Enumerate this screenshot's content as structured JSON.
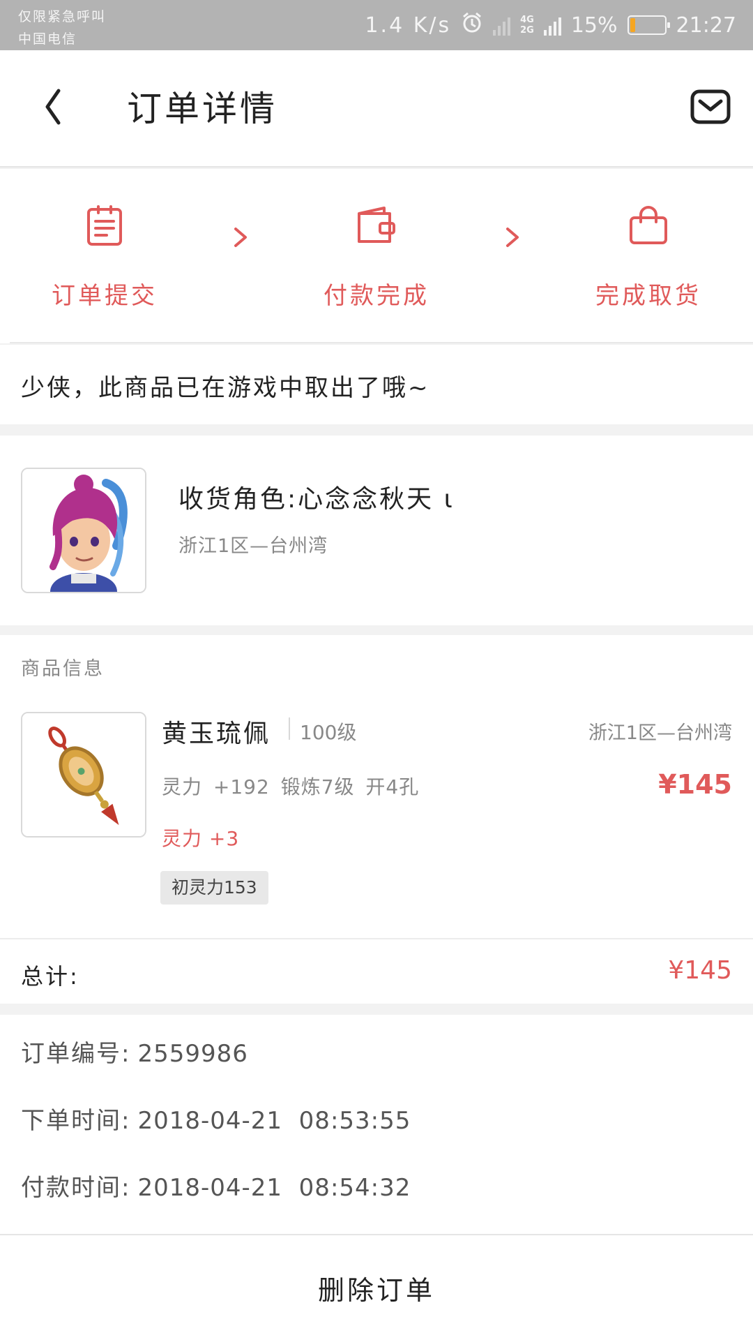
{
  "status_bar": {
    "emergency_text": "仅限紧急呼叫",
    "carrier": "中国电信",
    "speed": "1.4 K/s",
    "net_type_top": "4G",
    "net_type_bottom": "2G",
    "battery": "15%",
    "battery_level": 0.15,
    "time": "21:27"
  },
  "header": {
    "title": "订单详情",
    "back_icon": "chevron-left-icon",
    "mail_icon": "mail-icon"
  },
  "steps": [
    {
      "label": "订单提交",
      "icon": "clipboard-icon"
    },
    {
      "label": "付款完成",
      "icon": "wallet-icon"
    },
    {
      "label": "完成取货",
      "icon": "shopping-bag-icon"
    }
  ],
  "notice": "少侠，此商品已在游戏中取出了哦~",
  "role": {
    "name": "收货角色:心念念秋天 ι",
    "server": "浙江1区—台州湾"
  },
  "goods": {
    "section_title": "商品信息",
    "name": "黄玉琉佩",
    "level": "100级",
    "server": "浙江1区—台州湾",
    "attrs": "灵力 +192 锻炼7级 开4孔",
    "price": "¥145",
    "bonus": "灵力 +3",
    "tag": "初灵力153"
  },
  "total": {
    "label": "总计:",
    "value": "¥145"
  },
  "order_info": {
    "number_label": "订单编号:",
    "number": "2559986",
    "order_time_label": "下单时间:",
    "order_time": "2018-04-21  08:53:55",
    "pay_time_label": "付款时间:",
    "pay_time": "2018-04-21  08:54:32"
  },
  "actions": {
    "delete_label": "删除订单"
  },
  "colors": {
    "accent": "#e05a5a",
    "status_bar": "#b3b3b3",
    "battery_fill": "#f5a623"
  }
}
